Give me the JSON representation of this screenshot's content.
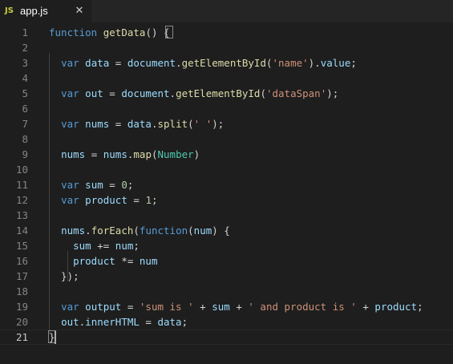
{
  "tab": {
    "icon_text": "JS",
    "file_name": "app.js",
    "close_glyph": "✕"
  },
  "editor": {
    "current_line": 21,
    "lines": [
      {
        "n": "1",
        "tokens": [
          [
            "kw",
            "function"
          ],
          [
            "pun",
            " "
          ],
          [
            "fn",
            "getData"
          ],
          [
            "pun",
            "() {"
          ]
        ]
      },
      {
        "n": "2",
        "tokens": []
      },
      {
        "n": "3",
        "tokens": [
          [
            "pun",
            "  "
          ],
          [
            "kw",
            "var"
          ],
          [
            "pun",
            " "
          ],
          [
            "var",
            "data"
          ],
          [
            "pun",
            " = "
          ],
          [
            "var",
            "document"
          ],
          [
            "pun",
            "."
          ],
          [
            "fn",
            "getElementById"
          ],
          [
            "pun",
            "("
          ],
          [
            "str",
            "'name'"
          ],
          [
            "pun",
            ")."
          ],
          [
            "var",
            "value"
          ],
          [
            "pun",
            ";"
          ]
        ]
      },
      {
        "n": "4",
        "tokens": []
      },
      {
        "n": "5",
        "tokens": [
          [
            "pun",
            "  "
          ],
          [
            "kw",
            "var"
          ],
          [
            "pun",
            " "
          ],
          [
            "var",
            "out"
          ],
          [
            "pun",
            " = "
          ],
          [
            "var",
            "document"
          ],
          [
            "pun",
            "."
          ],
          [
            "fn",
            "getElementById"
          ],
          [
            "pun",
            "("
          ],
          [
            "str",
            "'dataSpan'"
          ],
          [
            "pun",
            ");"
          ]
        ]
      },
      {
        "n": "6",
        "tokens": []
      },
      {
        "n": "7",
        "tokens": [
          [
            "pun",
            "  "
          ],
          [
            "kw",
            "var"
          ],
          [
            "pun",
            " "
          ],
          [
            "var",
            "nums"
          ],
          [
            "pun",
            " = "
          ],
          [
            "var",
            "data"
          ],
          [
            "pun",
            "."
          ],
          [
            "fn",
            "split"
          ],
          [
            "pun",
            "("
          ],
          [
            "str",
            "' '"
          ],
          [
            "pun",
            ");"
          ]
        ]
      },
      {
        "n": "8",
        "tokens": []
      },
      {
        "n": "9",
        "tokens": [
          [
            "pun",
            "  "
          ],
          [
            "var",
            "nums"
          ],
          [
            "pun",
            " = "
          ],
          [
            "var",
            "nums"
          ],
          [
            "pun",
            "."
          ],
          [
            "fn",
            "map"
          ],
          [
            "pun",
            "("
          ],
          [
            "typ",
            "Number"
          ],
          [
            "pun",
            ")"
          ]
        ]
      },
      {
        "n": "10",
        "tokens": []
      },
      {
        "n": "11",
        "tokens": [
          [
            "pun",
            "  "
          ],
          [
            "kw",
            "var"
          ],
          [
            "pun",
            " "
          ],
          [
            "var",
            "sum"
          ],
          [
            "pun",
            " = "
          ],
          [
            "num",
            "0"
          ],
          [
            "pun",
            ";"
          ]
        ]
      },
      {
        "n": "12",
        "tokens": [
          [
            "pun",
            "  "
          ],
          [
            "kw",
            "var"
          ],
          [
            "pun",
            " "
          ],
          [
            "var",
            "product"
          ],
          [
            "pun",
            " = "
          ],
          [
            "num",
            "1"
          ],
          [
            "pun",
            ";"
          ]
        ]
      },
      {
        "n": "13",
        "tokens": []
      },
      {
        "n": "14",
        "tokens": [
          [
            "pun",
            "  "
          ],
          [
            "var",
            "nums"
          ],
          [
            "pun",
            "."
          ],
          [
            "fn",
            "forEach"
          ],
          [
            "pun",
            "("
          ],
          [
            "kw",
            "function"
          ],
          [
            "pun",
            "("
          ],
          [
            "var",
            "num"
          ],
          [
            "pun",
            ") {"
          ]
        ]
      },
      {
        "n": "15",
        "tokens": [
          [
            "pun",
            "    "
          ],
          [
            "var",
            "sum"
          ],
          [
            "pun",
            " += "
          ],
          [
            "var",
            "num"
          ],
          [
            "pun",
            ";"
          ]
        ]
      },
      {
        "n": "16",
        "tokens": [
          [
            "pun",
            "    "
          ],
          [
            "var",
            "product"
          ],
          [
            "pun",
            " *= "
          ],
          [
            "var",
            "num"
          ]
        ]
      },
      {
        "n": "17",
        "tokens": [
          [
            "pun",
            "  });"
          ]
        ]
      },
      {
        "n": "18",
        "tokens": []
      },
      {
        "n": "19",
        "tokens": [
          [
            "pun",
            "  "
          ],
          [
            "kw",
            "var"
          ],
          [
            "pun",
            " "
          ],
          [
            "var",
            "output"
          ],
          [
            "pun",
            " = "
          ],
          [
            "str",
            "'sum is '"
          ],
          [
            "pun",
            " + "
          ],
          [
            "var",
            "sum"
          ],
          [
            "pun",
            " + "
          ],
          [
            "str",
            "' and product is '"
          ],
          [
            "pun",
            " + "
          ],
          [
            "var",
            "product"
          ],
          [
            "pun",
            ";"
          ]
        ]
      },
      {
        "n": "20",
        "tokens": [
          [
            "pun",
            "  "
          ],
          [
            "var",
            "out"
          ],
          [
            "pun",
            "."
          ],
          [
            "var",
            "innerHTML"
          ],
          [
            "pun",
            " = "
          ],
          [
            "var",
            "data"
          ],
          [
            "pun",
            ";"
          ]
        ]
      },
      {
        "n": "21",
        "tokens": [
          [
            "pun",
            "}"
          ]
        ]
      }
    ]
  },
  "colors": {
    "background": "#1e1e1e",
    "tabbar": "#252526",
    "keyword": "#569cd6",
    "function": "#dcdcaa",
    "variable": "#9cdcfe",
    "string": "#ce9178",
    "number": "#b5cea8",
    "type": "#4ec9b0",
    "js_icon": "#cbcb41"
  }
}
